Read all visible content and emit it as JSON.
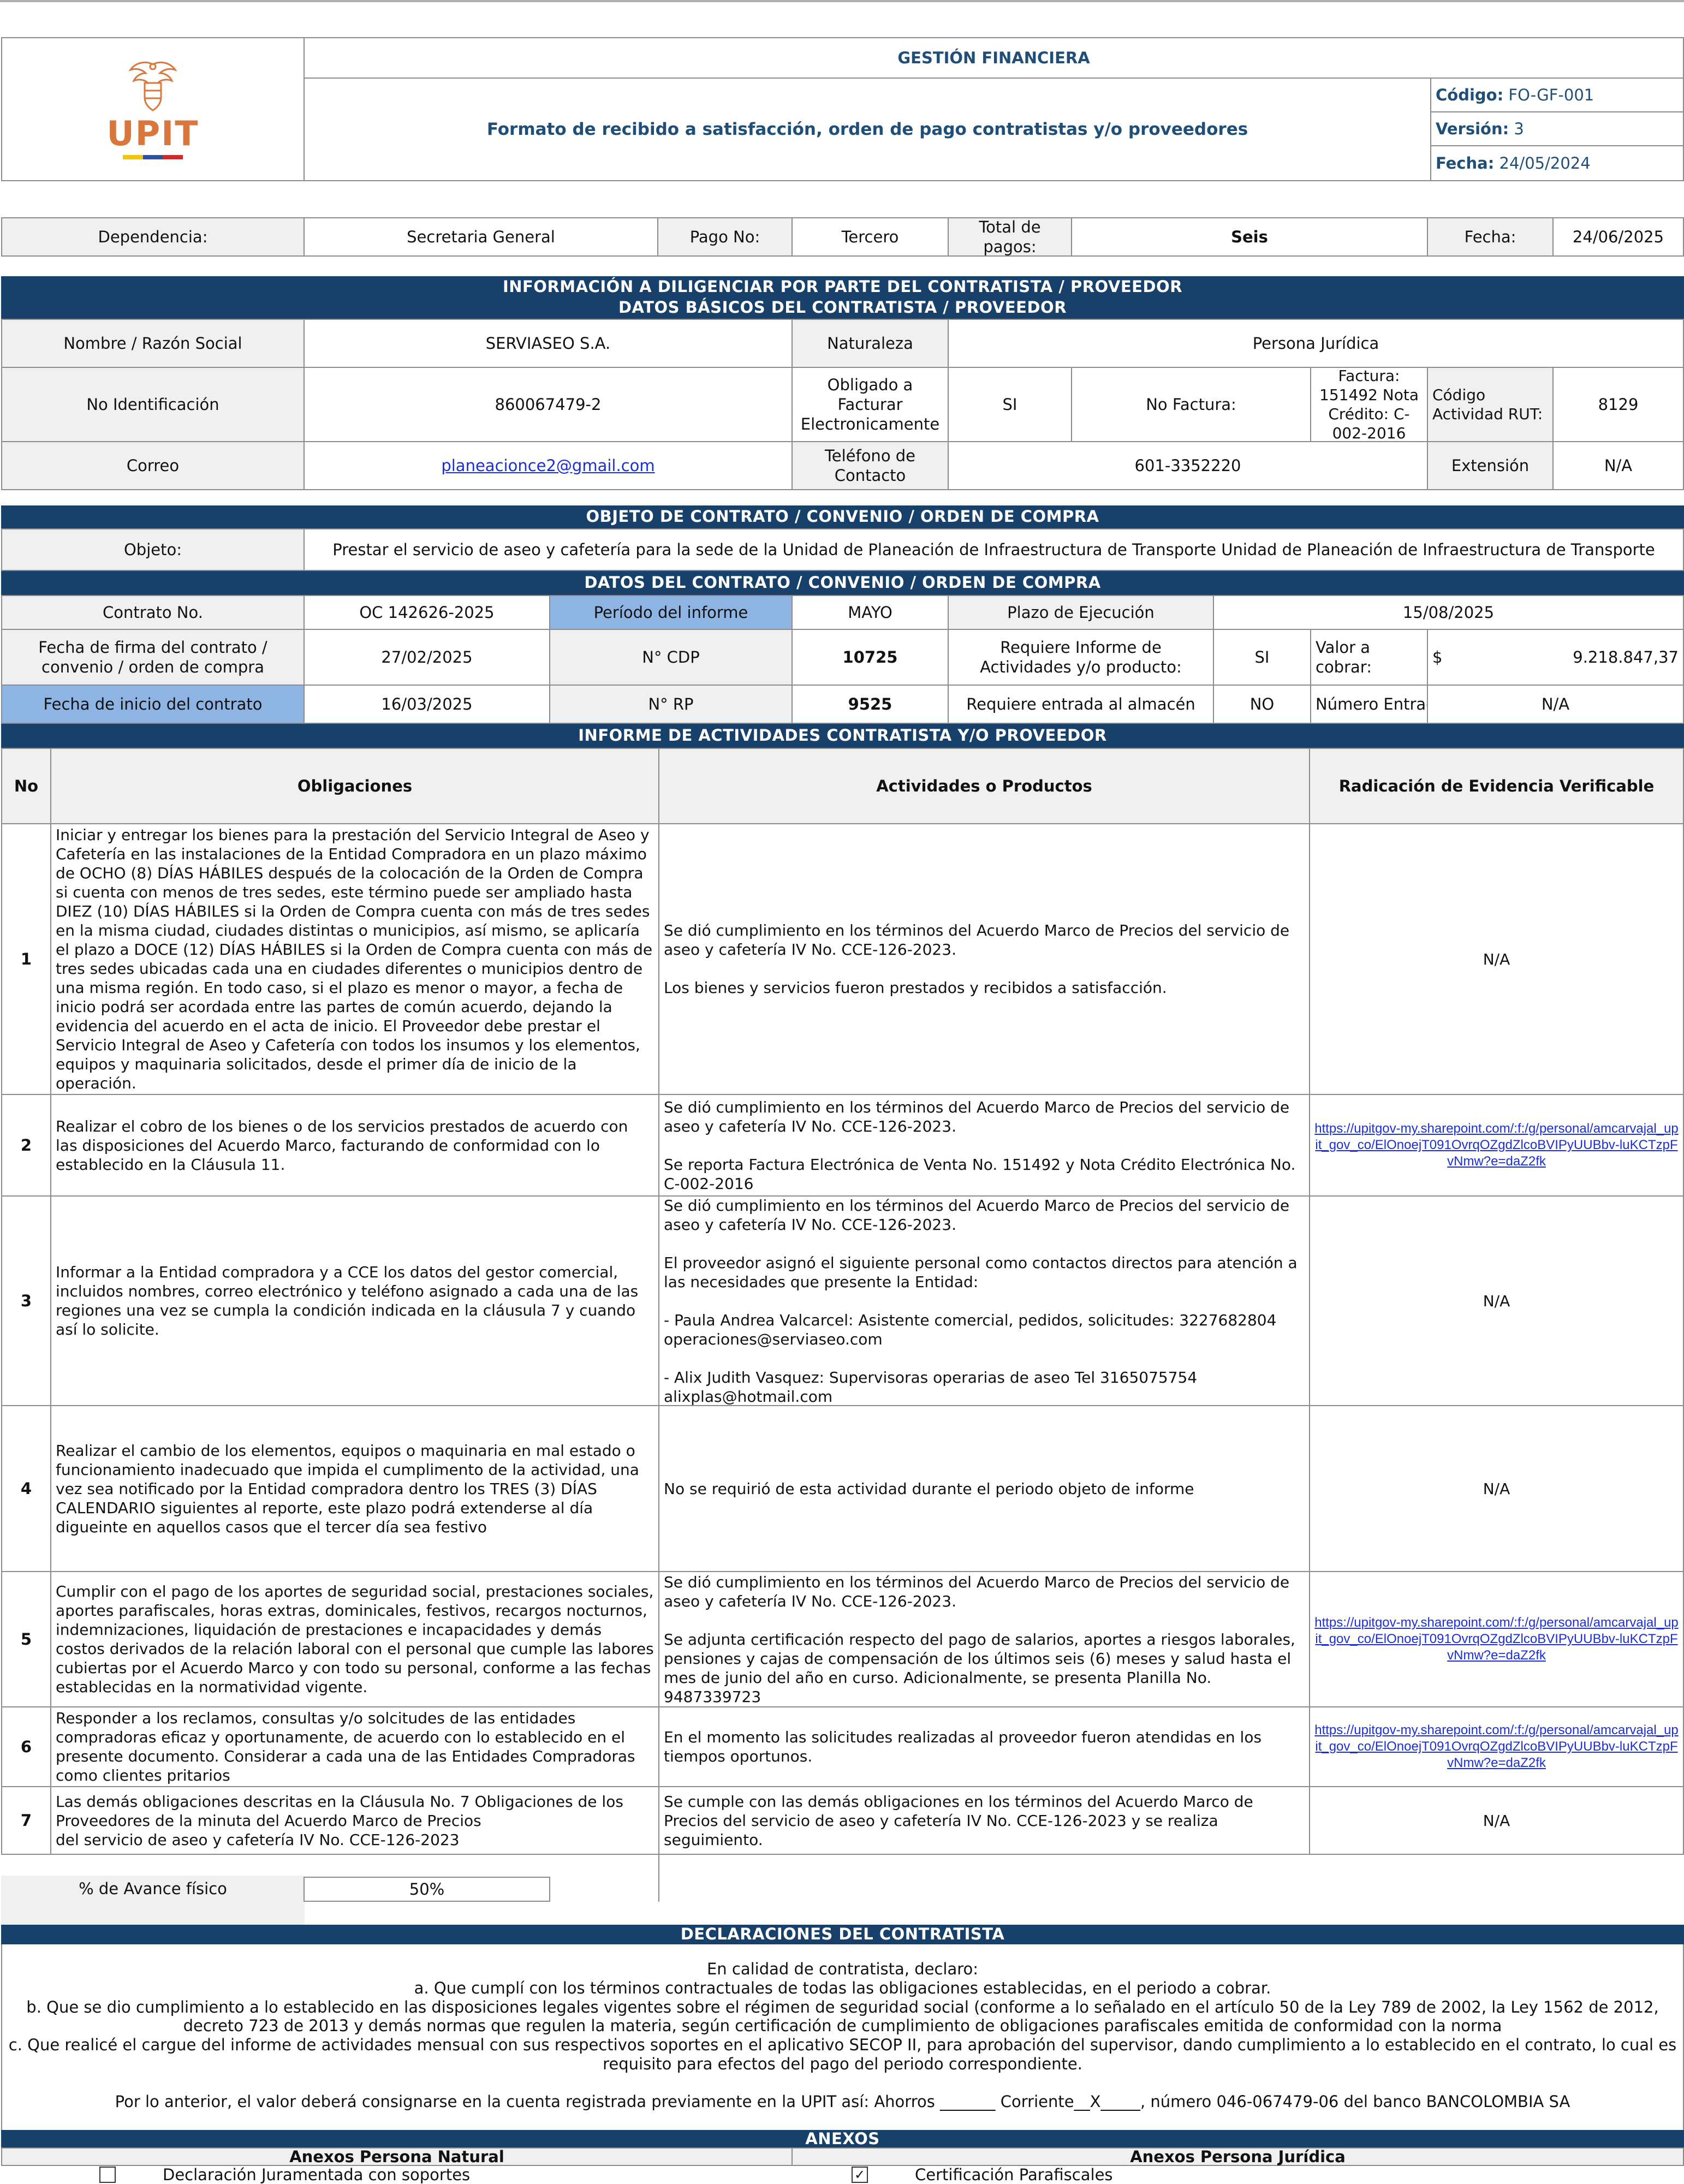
{
  "header": {
    "logo_text": "UPIT",
    "area": "GESTIÓN FINANCIERA",
    "title": "Formato de recibido a satisfacción, orden de pago contratistas y/o proveedores",
    "codigo_label": "Código:",
    "codigo_value": "FO-GF-001",
    "version_label": "Versión:",
    "version_value": "3",
    "fecha_label": "Fecha:",
    "fecha_value": "24/05/2024"
  },
  "summary": {
    "dependencia_label": "Dependencia:",
    "dependencia_value": "Secretaria General",
    "pago_label": "Pago No:",
    "pago_value": "Tercero",
    "total_label": "Total de pagos:",
    "total_value": "Seis",
    "fecha_label": "Fecha:",
    "fecha_value": "24/06/2025"
  },
  "section1": {
    "title_line1": "INFORMACIÓN A DILIGENCIAR POR PARTE DEL CONTRATISTA / PROVEEDOR",
    "title_line2": "DATOS BÁSICOS DEL CONTRATISTA / PROVEEDOR",
    "nombre_label": "Nombre / Razón Social",
    "nombre_value": "SERVIASEO S.A.",
    "naturaleza_label": "Naturaleza",
    "naturaleza_value": "Persona Jurídica",
    "id_label": "No Identificación",
    "id_value": "860067479-2",
    "obligado_label": "Obligado a Facturar Electronicamente",
    "obligado_value": "SI",
    "factura_label": "No Factura:",
    "factura_value": "Factura: 151492 Nota Crédito: C-002-2016",
    "ciiu_label": "Código Actividad RUT:",
    "ciiu_value": "8129",
    "correo_label": "Correo",
    "correo_value": "planeacionce2@gmail.com",
    "telefono_label": "Teléfono de Contacto",
    "telefono_value": "601-3352220",
    "extension_label": "Extensión",
    "extension_value": "N/A"
  },
  "section2": {
    "title": "OBJETO DE CONTRATO / CONVENIO / ORDEN DE COMPRA",
    "objeto_label": "Objeto:",
    "objeto_value": "Prestar el servicio de aseo y cafetería para la sede de la Unidad de Planeación de Infraestructura de Transporte Unidad de Planeación de Infraestructura de Transporte"
  },
  "section3": {
    "title": "DATOS DEL CONTRATO / CONVENIO / ORDEN DE COMPRA",
    "contrato_label": "Contrato No.",
    "contrato_value": "OC 142626-2025",
    "periodo_label": "Período del informe",
    "periodo_value": "MAYO",
    "plazo_label": "Plazo de Ejecución",
    "plazo_value": "15/08/2025",
    "firma_label": "Fecha de firma del contrato / convenio / orden de compra",
    "firma_value": "27/02/2025",
    "cdp_label": "N° CDP",
    "cdp_value": "10725",
    "informe_label": "Requiere Informe de Actividades y/o producto:",
    "informe_value": "SI",
    "valor_label": "Valor a cobrar:",
    "valor_currency": "$",
    "valor_value": "9.218.847,37",
    "inicio_label": "Fecha de inicio del contrato",
    "inicio_value": "16/03/2025",
    "rp_label": "N° RP",
    "rp_value": "9525",
    "almacen_label": "Requiere entrada al almacén",
    "almacen_value": "NO",
    "entrada_label": "Número Entrada",
    "entrada_value": "N/A"
  },
  "section4": {
    "title": "INFORME DE ACTIVIDADES CONTRATISTA Y/O PROVEEDOR",
    "col_no": "No",
    "col_obligaciones": "Obligaciones",
    "col_actividades": "Actividades o Productos",
    "col_evidencia": "Radicación de Evidencia Verificable",
    "rows": [
      {
        "no": "1",
        "obligacion": "Iniciar y entregar los bienes para la prestación del Servicio Integral de Aseo y Cafetería en las instalaciones de la Entidad Compradora en un plazo máximo de OCHO (8) DÍAS HÁBILES después de la colocación de la Orden de Compra si cuenta con menos de tres sedes, este término puede ser ampliado hasta DIEZ (10) DÍAS HÁBILES si la Orden de Compra cuenta con más de tres sedes en la misma ciudad, ciudades distintas o municipios, así mismo, se aplicaría el plazo a DOCE (12) DÍAS HÁBILES si la Orden de Compra cuenta con más de tres sedes ubicadas cada una en ciudades diferentes o municipios dentro de una misma región. En todo caso, si el plazo es menor o mayor, a fecha de inicio podrá ser acordada entre las partes de común acuerdo, dejando la evidencia del acuerdo en el acta de inicio. El Proveedor debe prestar el Servicio Integral de Aseo y Cafetería con todos los insumos y los elementos, equipos y maquinaria solicitados, desde el primer día de inicio de la operación.",
        "actividad": "Se dió cumplimiento en los términos del Acuerdo Marco de Precios del servicio de aseo y cafetería IV No. CCE-126-2023.\n\nLos bienes y servicios fueron prestados y recibidos a satisfacción.",
        "evidencia": "N/A"
      },
      {
        "no": "2",
        "obligacion": "Realizar el cobro de los bienes o de los servicios prestados de acuerdo con las disposiciones del Acuerdo Marco, facturando de conformidad con lo establecido en la Cláusula 11.",
        "actividad": "Se dió cumplimiento en los términos del Acuerdo Marco de Precios del servicio de aseo y cafetería IV No. CCE-126-2023.\n\nSe reporta Factura Electrónica de Venta No. 151492 y Nota Crédito Electrónica No. C-002-2016",
        "evidencia": "https://upitgov-my.sharepoint.com/:f:/g/personal/amcarvajal_upit_gov_co/ElOnoejT091OvrqOZgdZlcoBVIPyUUBbv-luKCTzpFvNmw?e=daZ2fk"
      },
      {
        "no": "3",
        "obligacion": "Informar a la Entidad compradora y a CCE los datos del gestor comercial, incluidos nombres, correo electrónico y teléfono asignado a cada una de las regiones una vez se cumpla la condición indicada en la cláusula 7 y cuando así lo solicite.",
        "actividad": "Se dió cumplimiento en los términos del Acuerdo Marco de Precios del servicio de aseo y cafetería IV No. CCE-126-2023.\n\nEl proveedor asignó el siguiente personal como contactos directos para atención a las necesidades que presente la Entidad:\n\n- Paula Andrea Valcarcel: Asistente comercial, pedidos, solicitudes: 3227682804 operaciones@serviaseo.com\n\n- Alix Judith Vasquez: Supervisoras operarias de aseo Tel 3165075754 alixplas@hotmail.com",
        "evidencia": "N/A"
      },
      {
        "no": "4",
        "obligacion": "Realizar el cambio de los elementos, equipos o maquinaria en mal estado o funcionamiento inadecuado que impida el cumplimento de la actividad, una vez sea notificado por la Entidad compradora dentro los TRES (3) DÍAS CALENDARIO siguientes al reporte, este plazo podrá extenderse al día digueinte en aquellos casos que el tercer día sea festivo",
        "actividad": "No se requirió de esta actividad durante el periodo objeto de informe",
        "evidencia": "N/A"
      },
      {
        "no": "5",
        "obligacion": "Cumplir con el pago de los aportes de seguridad social, prestaciones sociales, aportes parafiscales, horas extras, dominicales, festivos, recargos nocturnos, indemnizaciones, liquidación de prestaciones e incapacidades y demás costos derivados de la relación laboral con el personal que cumple las labores cubiertas por el Acuerdo Marco y con todo su personal, conforme a las fechas establecidas en la normatividad vigente.",
        "actividad": "Se dió cumplimiento en los términos del Acuerdo Marco de Precios del servicio de aseo y cafetería IV No. CCE-126-2023.\n\nSe adjunta certificación respecto del pago de salarios, aportes a riesgos laborales, pensiones y cajas de compensación de los últimos seis (6) meses y salud hasta el mes de junio del año en curso. Adicionalmente, se presenta Planilla No. 9487339723",
        "evidencia": "https://upitgov-my.sharepoint.com/:f:/g/personal/amcarvajal_upit_gov_co/ElOnoejT091OvrqOZgdZlcoBVIPyUUBbv-luKCTzpFvNmw?e=daZ2fk"
      },
      {
        "no": "6",
        "obligacion": "Responder a los reclamos, consultas y/o solcitudes de las entidades compradoras eficaz y oportunamente, de acuerdo con lo establecido en el presente documento. Considerar a cada una de las Entidades Compradoras como clientes pritarios",
        "actividad": "En el momento las solicitudes realizadas al proveedor fueron atendidas en los tiempos oportunos.",
        "evidencia": "https://upitgov-my.sharepoint.com/:f:/g/personal/amcarvajal_upit_gov_co/ElOnoejT091OvrqOZgdZlcoBVIPyUUBbv-luKCTzpFvNmw?e=daZ2fk"
      },
      {
        "no": "7",
        "obligacion": "Las demás obligaciones descritas en la Cláusula No. 7 Obligaciones de los Proveedores de la minuta del Acuerdo Marco de Precios\ndel servicio de aseo y cafetería IV No. CCE-126-2023",
        "actividad": "Se cumple con las demás obligaciones en los términos del Acuerdo Marco de Precios del servicio de aseo y cafetería IV No. CCE-126-2023 y se realiza seguimiento.",
        "evidencia": "N/A"
      }
    ],
    "avance_label": "% de Avance físico",
    "avance_value": "50%"
  },
  "section5": {
    "title": "DECLARACIONES DEL CONTRATISTA",
    "intro": "En calidad de contratista, declaro:",
    "a": "a. Que cumplí con los términos contractuales de todas las obligaciones establecidas, en el periodo a cobrar.",
    "b": "b. Que se dio cumplimiento a lo establecido en las disposiciones legales vigentes sobre el régimen de seguridad social (conforme a lo señalado en el artículo 50 de la Ley 789 de 2002, la Ley 1562 de 2012, decreto 723 de 2013 y demás normas que regulen la materia, según certificación de cumplimiento de obligaciones parafiscales emitida de conformidad con la norma",
    "c": "c. Que realicé el cargue del informe de actividades mensual con sus respectivos soportes en el aplicativo SECOP II, para aprobación del supervisor, dando cumplimiento a lo establecido en el contrato, lo cual es requisito para efectos del pago del periodo correspondiente.",
    "cuenta": "Por lo anterior, el valor deberá consignarse en la cuenta registrada previamente en la UPIT así:  Ahorros _______  Corriente__X_____, número 046-067479-06 del banco BANCOLOMBIA SA"
  },
  "section6": {
    "title": "ANEXOS",
    "natural_header": "Anexos Persona Natural",
    "juridica_header": "Anexos Persona Jurídica",
    "natural_item": "Declaración Juramentada con soportes",
    "natural_checked": false,
    "juridica_item": "Certificación Parafiscales",
    "juridica_checked": true
  },
  "colors": {
    "navy": "#17416b",
    "header_text": "#1f4e79",
    "light_blue": "#8db4e2",
    "gray": "#f0f0f0",
    "logo_orange": "#d9773d"
  }
}
